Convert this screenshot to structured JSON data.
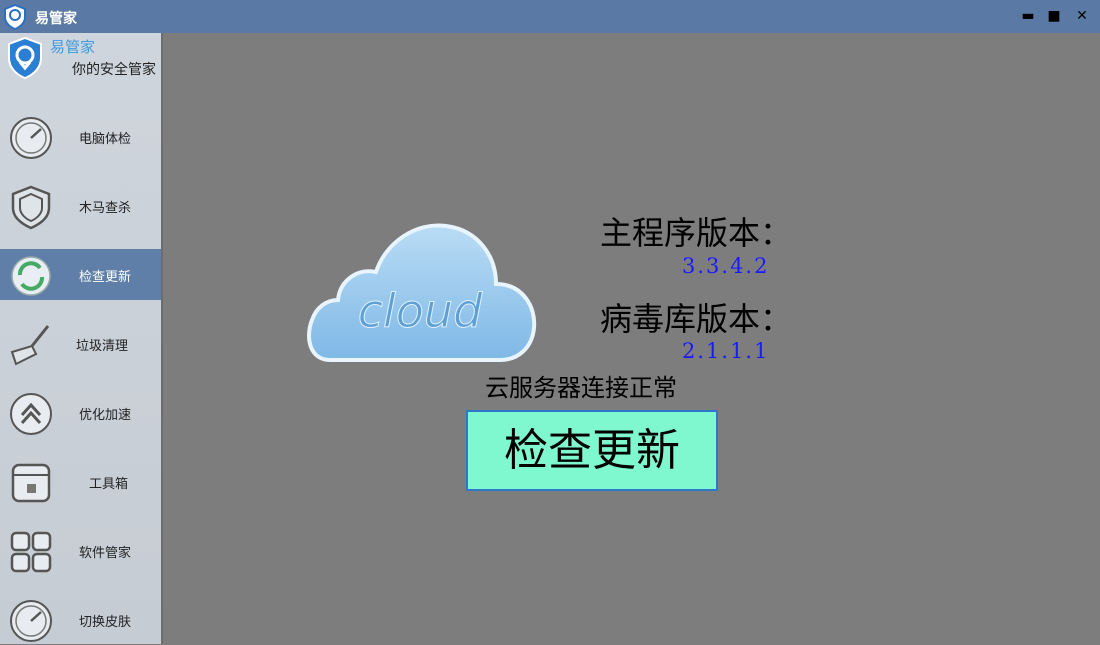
{
  "window": {
    "title": "易管家",
    "minimize": "▬",
    "maximize": "■",
    "close": "✕"
  },
  "brand": {
    "name": "易管家",
    "tagline": "你的安全管家"
  },
  "sidebar": {
    "items": [
      {
        "label": "电脑体检",
        "icon": "gauge-icon"
      },
      {
        "label": "木马查杀",
        "icon": "shield-icon"
      },
      {
        "label": "检查更新",
        "icon": "refresh-icon",
        "active": true
      },
      {
        "label": "垃圾清理",
        "icon": "broom-icon"
      },
      {
        "label": "优化加速",
        "icon": "speedup-icon"
      },
      {
        "label": "工具箱",
        "icon": "toolbox-icon"
      },
      {
        "label": "软件管家",
        "icon": "grid-icon"
      },
      {
        "label": "切换皮肤",
        "icon": "gauge-icon"
      }
    ]
  },
  "main": {
    "cloud_text": "cloud",
    "main_version_label": "主程序版本：",
    "main_version": "3.3.4.2",
    "virus_db_label": "病毒库版本：",
    "virus_db_version": "2.1.1.1",
    "server_status": "云服务器连接正常",
    "check_button": "检查更新"
  },
  "colors": {
    "titlebar": "#5a7aa5",
    "active_item": "#5f7fa8",
    "button": "#7ff7cf",
    "version_text": "#1a1aff"
  }
}
